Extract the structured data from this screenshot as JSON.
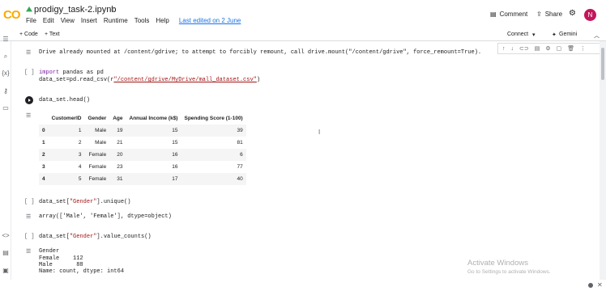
{
  "app": {
    "logo": "CO"
  },
  "header": {
    "title": "prodigy_task-2.ipynb",
    "menus": [
      "File",
      "Edit",
      "View",
      "Insert",
      "Runtime",
      "Tools",
      "Help"
    ],
    "last_edited": "Last edited on 2 June",
    "comment": "Comment",
    "share": "Share",
    "avatar": "N"
  },
  "toolbar": {
    "code": "+ Code",
    "text": "+ Text",
    "connect": "Connect",
    "gemini": "Gemini"
  },
  "cells": {
    "mount_output": "Drive already mounted at /content/gdrive; to attempt to forcibly remount, call drive.mount(\"/content/gdrive\", force_remount=True).",
    "cell1_bracket": "[ ]",
    "cell1_line1_kw": "import",
    "cell1_line1_rest": " pandas as pd",
    "cell1_line2_pre": "data_set=pd.read_csv(r",
    "cell1_line2_path": "\"/content/gdrive/MyDrive/mall_dataset.csv\"",
    "cell1_line2_post": ")",
    "cell2_code": "data_set.head()",
    "cell3_bracket": "[ ]",
    "cell3_code_pre": "data_set[",
    "cell3_code_str": "\"Gender\"",
    "cell3_code_post": "].unique()",
    "cell3_output": "array(['Male', 'Female'], dtype=object)",
    "cell4_bracket": "[ ]",
    "cell4_code_pre": "data_set[",
    "cell4_code_str": "\"Gender\"",
    "cell4_code_post": "].value_counts()",
    "cell4_output": [
      "Gender",
      "Female    112",
      "Male       88",
      "Name: count, dtype: int64"
    ]
  },
  "table": {
    "columns": [
      "CustomerID",
      "Gender",
      "Age",
      "Annual Income (k$)",
      "Spending Score (1-100)"
    ],
    "rows": [
      {
        "index": "0",
        "values": [
          "1",
          "Male",
          "19",
          "15",
          "39"
        ]
      },
      {
        "index": "1",
        "values": [
          "2",
          "Male",
          "21",
          "15",
          "81"
        ]
      },
      {
        "index": "2",
        "values": [
          "3",
          "Female",
          "20",
          "16",
          "6"
        ]
      },
      {
        "index": "3",
        "values": [
          "4",
          "Female",
          "23",
          "16",
          "77"
        ]
      },
      {
        "index": "4",
        "values": [
          "5",
          "Female",
          "31",
          "17",
          "40"
        ]
      }
    ]
  },
  "watermark": {
    "title": "Activate Windows",
    "subtitle": "Go to Settings to activate Windows."
  },
  "colors": {
    "accent": "#1a73e8",
    "logo": "#f9ab00",
    "avatar": "#c2185b"
  }
}
